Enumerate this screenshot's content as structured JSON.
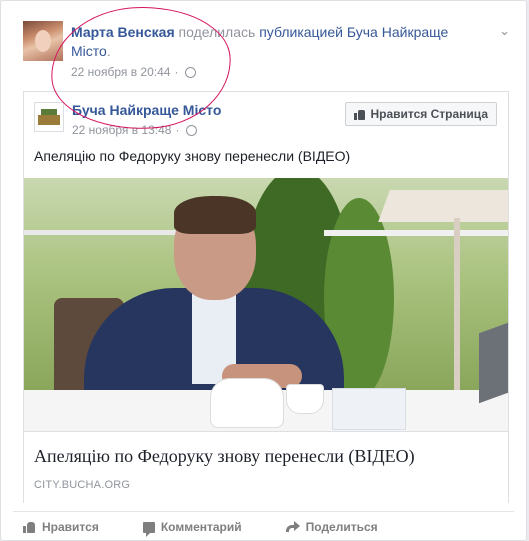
{
  "post": {
    "author_name": "Марта Венская",
    "action_text": "поделилась",
    "object_text": "публикацией Буча Найкраще Місто",
    "period": ".",
    "timestamp": "22 ноября в 20:44",
    "separator": "·",
    "privacy_icon": "globe-icon",
    "menu_icon": "chevron-down-icon"
  },
  "shared_post": {
    "page_name": "Буча Найкраще Місто",
    "timestamp": "22 ноября в 13:48",
    "separator": "·",
    "like_page_label": "Нравится Страница",
    "text": "Апеляцію по Федоруку знову перенесли (ВІДЕО)",
    "link_title": "Апеляцію по Федоруку знову перенесли (ВІДЕО)",
    "link_domain": "CITY.BUCHA.ORG"
  },
  "actions": {
    "like_label": "Нравится",
    "comment_label": "Комментарий",
    "share_label": "Поделиться"
  },
  "colors": {
    "link": "#365899",
    "muted": "#90949c",
    "annotation_circle": "#d4135d"
  }
}
